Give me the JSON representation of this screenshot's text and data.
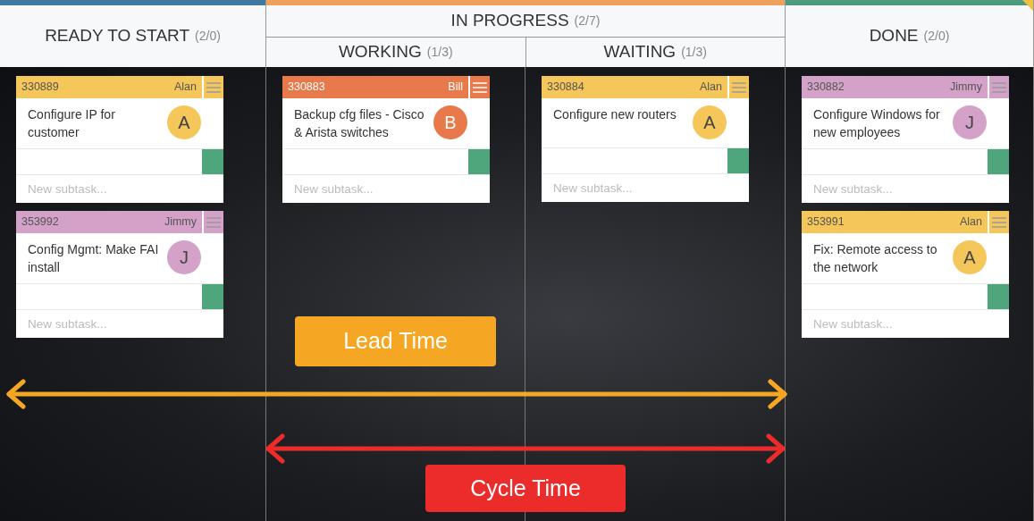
{
  "columns": [
    {
      "title": "READY TO START",
      "count": "(2/0)",
      "color": "#3f78a3",
      "cards": [
        {
          "id": "330889",
          "owner": "Alan",
          "title": "Configure IP for customer",
          "initial": "A",
          "color": "#f5c75a",
          "placeholder": "New subtask..."
        },
        {
          "id": "353992",
          "owner": "Jimmy",
          "title": "Config Mgmt: Make FAI install",
          "initial": "J",
          "color": "#d4a2c9",
          "placeholder": "New subtask..."
        }
      ]
    },
    {
      "title": "IN PROGRESS",
      "count": "(2/7)",
      "color": "#f0a05a",
      "subcolumns": [
        {
          "title": "WORKING",
          "count": "(1/3)",
          "cards": [
            {
              "id": "330883",
              "owner": "Bill",
              "title": "Backup cfg files - Cisco & Arista switches",
              "initial": "B",
              "color": "#e8794a",
              "placeholder": "New subtask..."
            }
          ]
        },
        {
          "title": "WAITING",
          "count": "(1/3)",
          "cards": [
            {
              "id": "330884",
              "owner": "Alan",
              "title": "Configure new routers",
              "initial": "A",
              "color": "#f5c75a",
              "placeholder": "New subtask..."
            }
          ]
        }
      ]
    },
    {
      "title": "DONE",
      "count": "(2/0)",
      "color": "#4e9a7c",
      "cards": [
        {
          "id": "330882",
          "owner": "Jimmy",
          "title": "Configure Windows for new employees",
          "initial": "J",
          "color": "#d4a2c9",
          "placeholder": "New subtask..."
        },
        {
          "id": "353991",
          "owner": "Alan",
          "title": "Fix: Remote access to the network",
          "initial": "A",
          "color": "#f5c75a",
          "placeholder": "New subtask..."
        }
      ]
    }
  ],
  "annotations": [
    {
      "kind": "lead",
      "label": "Lead Time"
    },
    {
      "kind": "cycle",
      "label": "Cycle Time"
    }
  ]
}
